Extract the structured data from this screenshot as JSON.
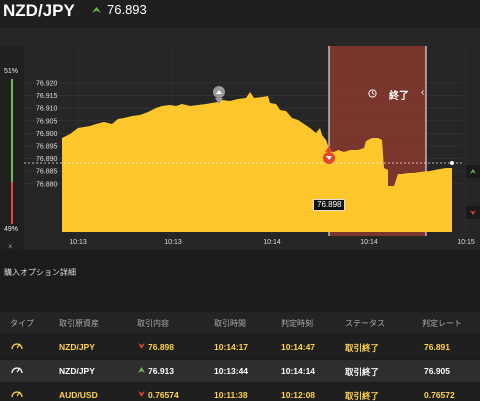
{
  "header": {
    "pair": "NZD/JPY",
    "price": "76.893",
    "trend_icon": "price-up-arrow-icon",
    "trend_color": "#6cc04a"
  },
  "chart": {
    "side": {
      "up_pct": "51%",
      "down_pct": "49%",
      "close": "×"
    },
    "y_ticks": [
      "76.920",
      "76.915",
      "76.910",
      "76.905",
      "76.900",
      "76.895",
      "76.890",
      "76.885",
      "76.880"
    ],
    "x_ticks": [
      "10:13",
      "10:13",
      "10:14",
      "10:14",
      "10:15"
    ],
    "band_label": "終了",
    "band_arrow": "‹",
    "current_price": "76.898",
    "fill_color": "#ffc72c",
    "band_color": "#8a3a2e"
  },
  "section": {
    "title": "購入オプション詳細"
  },
  "table": {
    "headers": [
      "タイプ",
      "取引原資産",
      "取引内容",
      "取引時間",
      "判定時刻",
      "ステータス",
      "判定レート"
    ],
    "rows": [
      {
        "pair": "NZD/JPY",
        "dir": "down",
        "content": "76.898",
        "time": "10:14:17",
        "judge_time": "10:14:47",
        "status": "取引終了",
        "rate": "76.891"
      },
      {
        "pair": "NZD/JPY",
        "dir": "up",
        "content": "76.913",
        "time": "10:13:44",
        "judge_time": "10:14:14",
        "status": "取引終了",
        "rate": "76.905"
      },
      {
        "pair": "AUD/USD",
        "dir": "down",
        "content": "0.76574",
        "time": "10:11:38",
        "judge_time": "10:12:08",
        "status": "取引終了",
        "rate": "0.76572"
      }
    ]
  },
  "colors": {
    "up": "#6cc04a",
    "down": "#e0472b",
    "accent": "#ffd34a"
  }
}
